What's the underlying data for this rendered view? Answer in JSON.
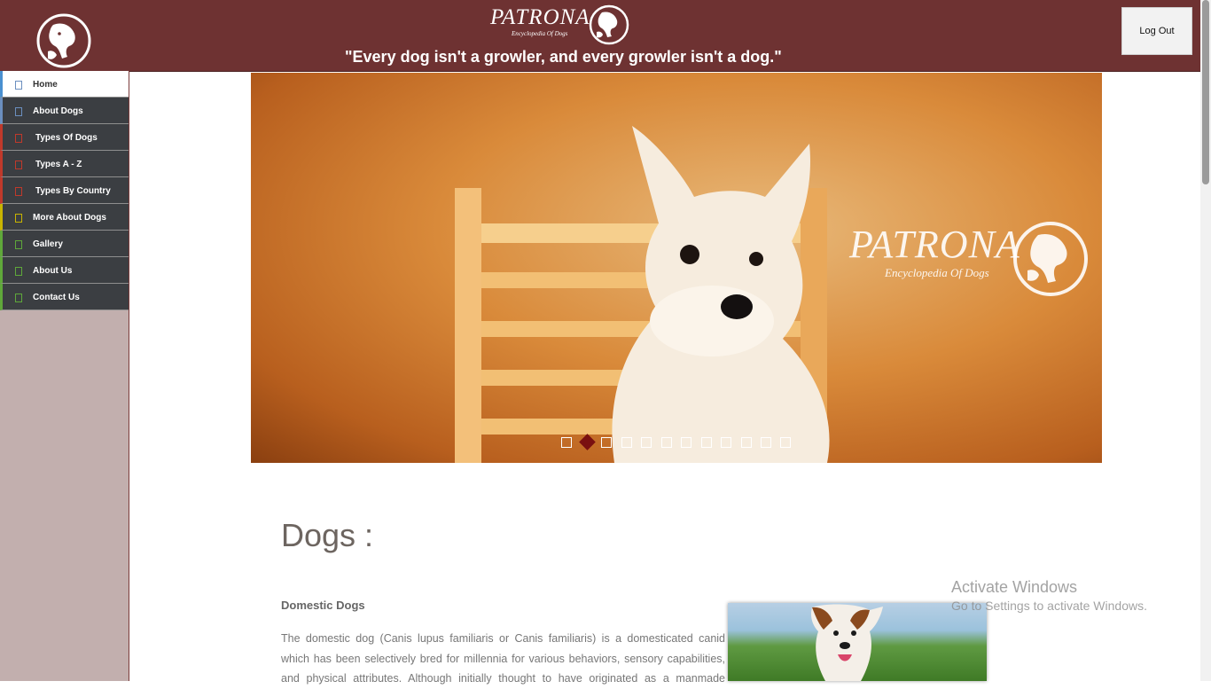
{
  "header": {
    "brand": "PATRONA",
    "brand_sub": "Encyclopedia Of Dogs",
    "quote": "\"Every dog isn't a growler, and every growler isn't a dog.\"",
    "logout_label": "Log Out"
  },
  "sidebar": {
    "items": [
      {
        "label": "Home",
        "accent": "#4a90d0",
        "active": true
      },
      {
        "label": "About Dogs",
        "accent": "#6b8fbf"
      },
      {
        "label": "Types Of Dogs",
        "accent": "#c0392b"
      },
      {
        "label": "Types A - Z",
        "accent": "#c0392b"
      },
      {
        "label": "Types By Country",
        "accent": "#c0392b"
      },
      {
        "label": "More About Dogs",
        "accent": "#c8b400"
      },
      {
        "label": "Gallery",
        "accent": "#5fa83a"
      },
      {
        "label": "About Us",
        "accent": "#5fa83a"
      },
      {
        "label": "Contact Us",
        "accent": "#5fa83a"
      }
    ]
  },
  "slider": {
    "watermark_title": "PATRONA",
    "watermark_sub": "Encyclopedia Of Dogs",
    "slide_count": 12,
    "active_index": 1
  },
  "content": {
    "title": "Dogs :",
    "subheading": "Domestic Dogs",
    "paragraph_lines": [
      "The domestic dog (Canis lupus familiaris or Canis familiaris) is a domesticated canid",
      "which has been selectively bred for millennia for various behaviors, sensory capabilities,",
      "and physical attributes. Although initially thought to have originated as a manmade"
    ]
  },
  "os_overlay": {
    "title": "Activate Windows",
    "subtitle": "Go to Settings to activate Windows."
  },
  "colors": {
    "header_bg": "#6e3232",
    "sidebar_bg": "#c2afae",
    "nav_bg": "#3b3e42",
    "active_dot": "#7a1010"
  }
}
